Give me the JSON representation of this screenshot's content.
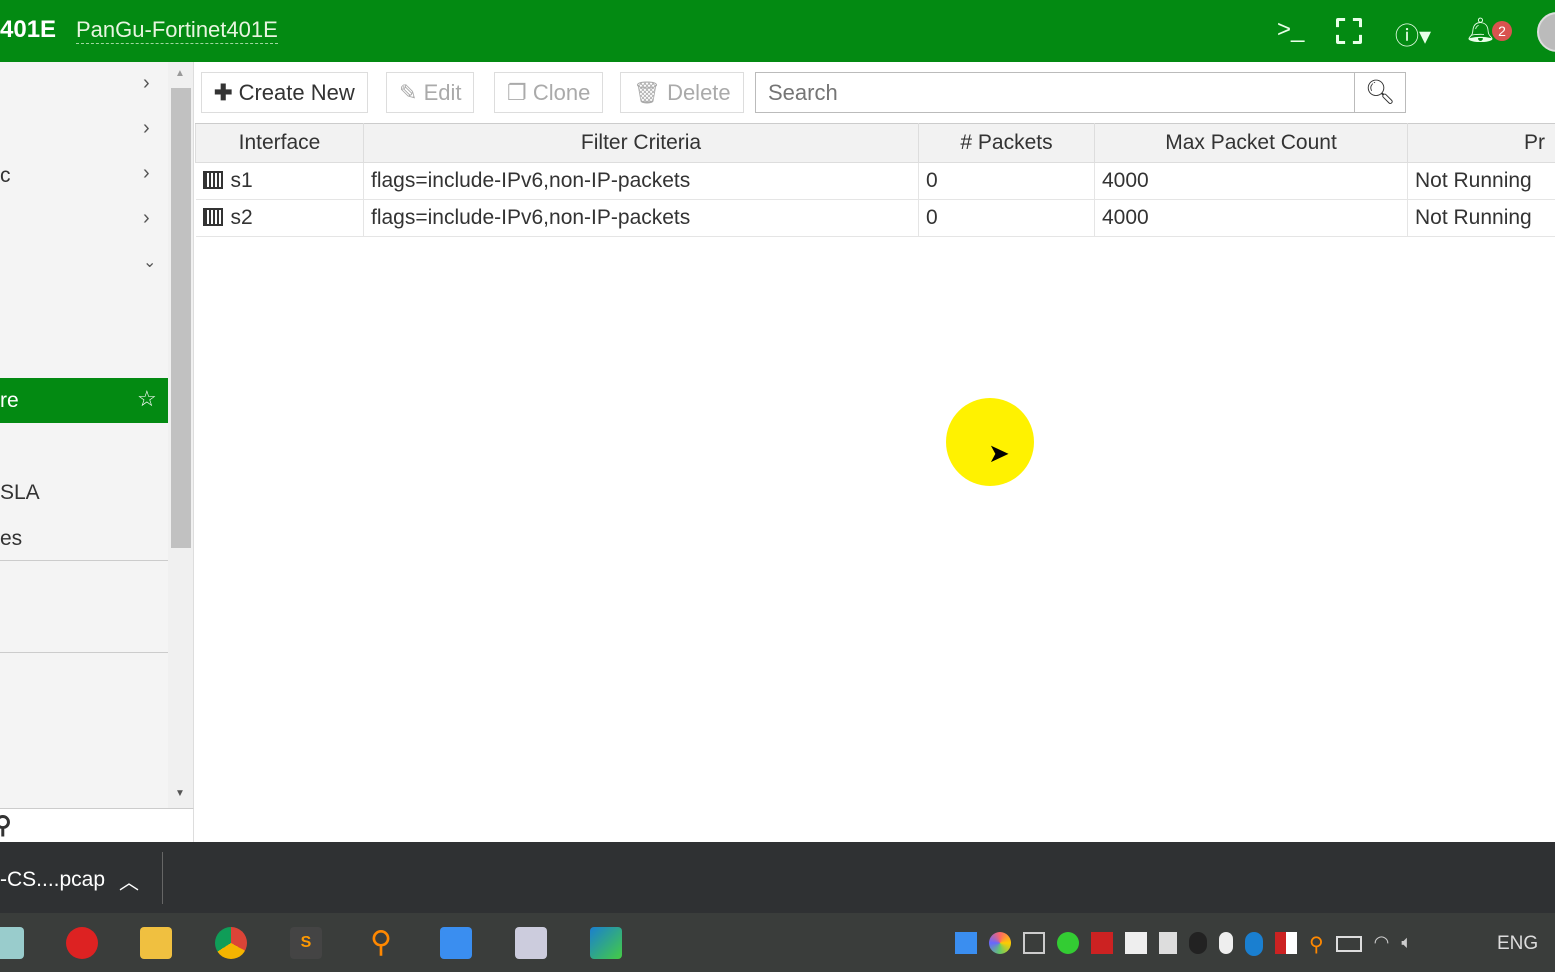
{
  "header": {
    "model": "401E",
    "hostname": "PanGu-Fortinet401E",
    "notification_count": "2",
    "icons": [
      "cli-console-icon",
      "fullscreen-icon",
      "help-icon",
      "bell-icon",
      "user-avatar"
    ]
  },
  "sidebar": {
    "items": [
      {
        "label": "",
        "icon": "chevron-right"
      },
      {
        "label": "",
        "icon": "chevron-right"
      },
      {
        "label": "c",
        "icon": "chevron-right"
      },
      {
        "label": "",
        "icon": "chevron-right"
      },
      {
        "label": "",
        "icon": "chevron-down"
      },
      {
        "label": "re",
        "selected": true,
        "icon": "star"
      },
      {
        "label": "SLA"
      },
      {
        "label": "es"
      }
    ]
  },
  "toolbar": {
    "create_new": "Create New",
    "edit": "Edit",
    "clone": "Clone",
    "delete": "Delete",
    "search_placeholder": "Search"
  },
  "table": {
    "columns": [
      "Interface",
      "Filter Criteria",
      "# Packets",
      "Max Packet Count",
      "Pr"
    ],
    "rows": [
      {
        "interface": "s1",
        "filter": "flags=include-IPv6,non-IP-packets",
        "packets": "0",
        "max": "4000",
        "progress": "Not Running"
      },
      {
        "interface": "s2",
        "filter": "flags=include-IPv6,non-IP-packets",
        "packets": "0",
        "max": "4000",
        "progress": "Not Running"
      }
    ]
  },
  "download_bar": {
    "file": "-CS....pcap"
  },
  "taskbar": {
    "language": "ENG",
    "accent": "#038a12"
  }
}
